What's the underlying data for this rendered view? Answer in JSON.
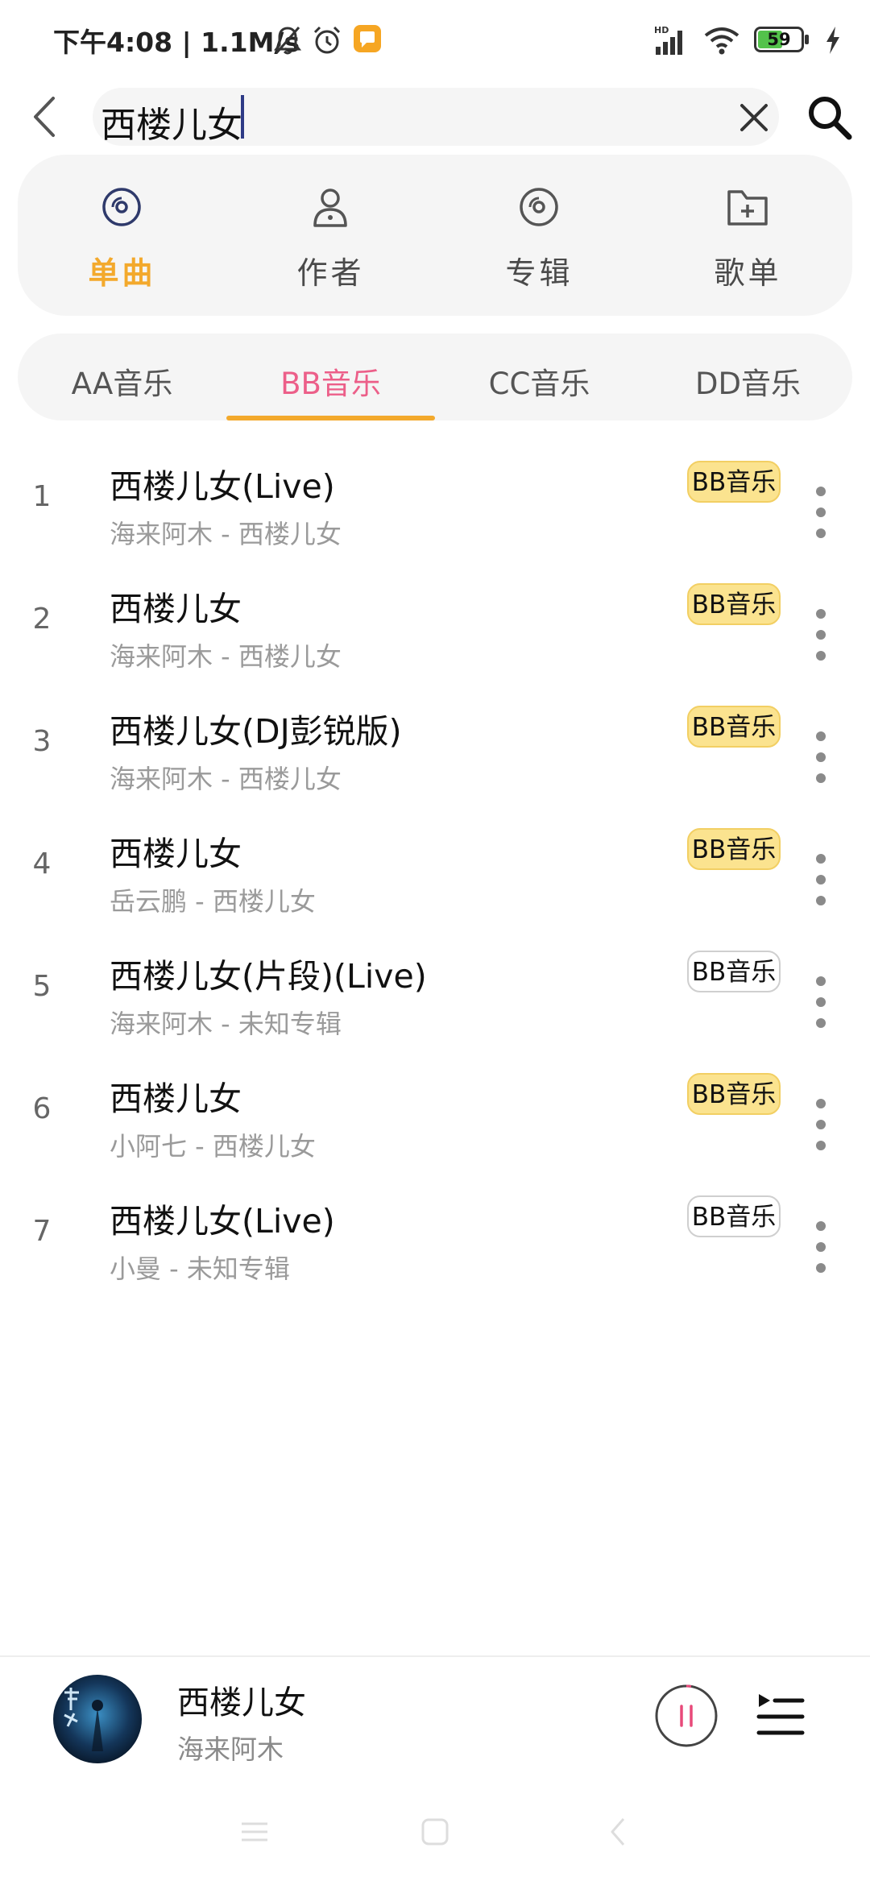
{
  "status_bar": {
    "time": "下午4:08 | 1.1M/s",
    "battery": "59",
    "icons": [
      "mute-icon",
      "alarm-icon",
      "notification-app-icon",
      "hd-signal-icon",
      "wifi-icon",
      "battery-icon",
      "charging-icon"
    ]
  },
  "search": {
    "query": "西楼儿女"
  },
  "categories": [
    {
      "label": "单曲",
      "icon": "disc-icon",
      "active": true
    },
    {
      "label": "作者",
      "icon": "person-icon",
      "active": false
    },
    {
      "label": "专辑",
      "icon": "album-icon",
      "active": false
    },
    {
      "label": "歌单",
      "icon": "folder-add-icon",
      "active": false
    }
  ],
  "tabs": [
    {
      "label": "AA音乐",
      "active": false
    },
    {
      "label": "BB音乐",
      "active": true
    },
    {
      "label": "CC音乐",
      "active": false
    },
    {
      "label": "DD音乐",
      "active": false
    }
  ],
  "songs": [
    {
      "num": "1",
      "title": "西楼儿女(Live)",
      "subtitle": "海来阿木 - 西楼儿女",
      "source": "BB音乐",
      "badge_style": "filled"
    },
    {
      "num": "2",
      "title": "西楼儿女",
      "subtitle": "海来阿木 - 西楼儿女",
      "source": "BB音乐",
      "badge_style": "filled"
    },
    {
      "num": "3",
      "title": "西楼儿女(DJ彭锐版)",
      "subtitle": "海来阿木 - 西楼儿女",
      "source": "BB音乐",
      "badge_style": "filled"
    },
    {
      "num": "4",
      "title": "西楼儿女",
      "subtitle": "岳云鹏 - 西楼儿女",
      "source": "BB音乐",
      "badge_style": "filled"
    },
    {
      "num": "5",
      "title": "西楼儿女(片段)(Live)",
      "subtitle": "海来阿木 - 未知专辑",
      "source": "BB音乐",
      "badge_style": "outline"
    },
    {
      "num": "6",
      "title": "西楼儿女",
      "subtitle": "小阿七 - 西楼儿女",
      "source": "BB音乐",
      "badge_style": "filled"
    },
    {
      "num": "7",
      "title": "西楼儿女(Live)",
      "subtitle": "小曼 - 未知专辑",
      "source": "BB音乐",
      "badge_style": "outline"
    }
  ],
  "player": {
    "title": "西楼儿女",
    "artist": "海来阿木",
    "state": "playing"
  },
  "colors": {
    "accent_orange": "#f3a92c",
    "accent_pink": "#ec5f89",
    "badge_yellow": "#fbe38f",
    "panel_bg": "#f5f5f5"
  }
}
